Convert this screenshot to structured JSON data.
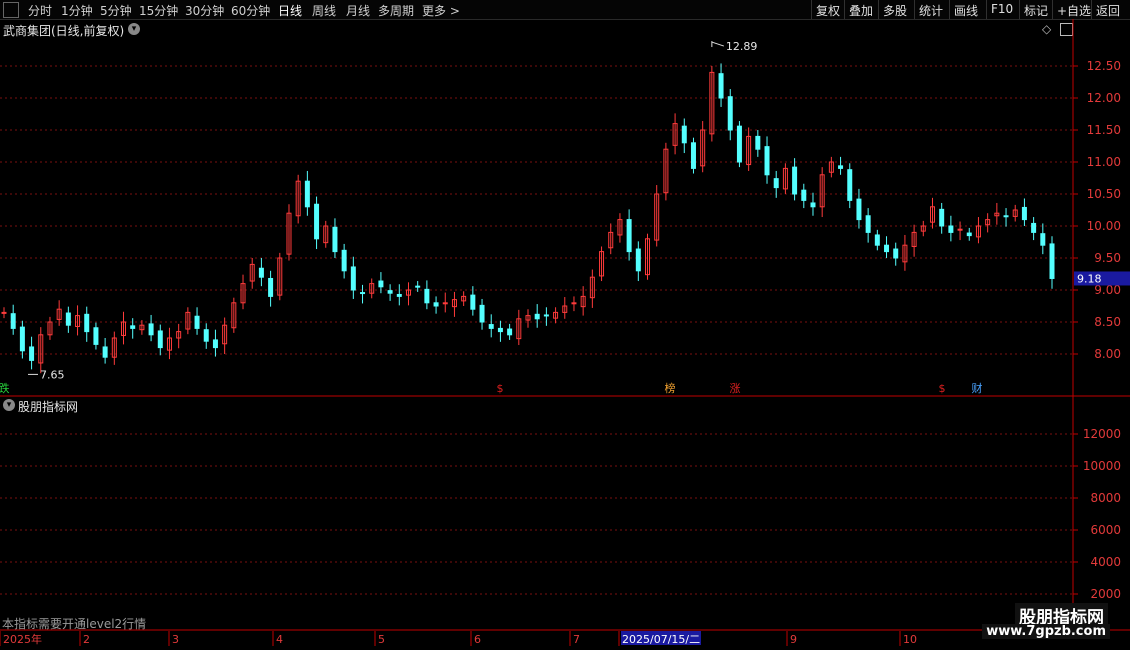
{
  "toolbar": {
    "left_items": [
      "分时",
      "1分钟",
      "5分钟",
      "15分钟",
      "30分钟",
      "60分钟",
      "日线",
      "周线",
      "月线",
      "多周期",
      "更多 >"
    ],
    "active_item": "日线",
    "right_items": [
      "复权",
      "叠加",
      "多股",
      "统计",
      "画线",
      "F10",
      "标记",
      "+自选",
      "返回"
    ]
  },
  "main_panel": {
    "title": "武商集团(日线,前复权)",
    "high_label": "12.89",
    "low_label": "7.65",
    "current_price": "9.18",
    "price_ticks": [
      "12.50",
      "12.00",
      "11.50",
      "11.00",
      "10.50",
      "10.00",
      "9.50",
      "9.00",
      "8.50",
      "8.00"
    ],
    "event_markers": [
      {
        "text": "跌",
        "color": "#27d13c"
      },
      {
        "text": "$",
        "color": "#e02020"
      },
      {
        "text": "榜",
        "color": "#f0a030"
      },
      {
        "text": "涨",
        "color": "#e02020"
      },
      {
        "text": "$",
        "color": "#e02020"
      },
      {
        "text": "财",
        "color": "#4aa3ff"
      }
    ]
  },
  "indicator_panel": {
    "title": "股朋指标网",
    "ticks": [
      "12000",
      "10000",
      "8000",
      "6000",
      "4000",
      "2000"
    ],
    "notice": "本指标需要开通level2行情"
  },
  "time_axis": {
    "labels": [
      "2025年",
      "2",
      "3",
      "4",
      "5",
      "6",
      "7",
      "2025/07/15/二",
      "9",
      "10"
    ],
    "highlight": "2025/07/15/二"
  },
  "watermark": {
    "title": "股朋指标网",
    "url": "www.7gpzb.com"
  },
  "colors": {
    "up": "#ff3b3b",
    "down": "#54ffff",
    "axis": "#c00000",
    "grid": "#7a1010",
    "price_box": "#1a1aa0"
  },
  "chart_data": {
    "type": "candlestick",
    "ylim": [
      7.5,
      13.0
    ],
    "highest": 12.89,
    "lowest": 7.65,
    "last": 9.18,
    "close_path": [
      8.65,
      8.4,
      8.05,
      7.9,
      8.3,
      8.5,
      8.7,
      8.45,
      8.6,
      8.35,
      8.15,
      7.95,
      8.25,
      8.5,
      8.4,
      8.45,
      8.3,
      8.1,
      8.25,
      8.35,
      8.65,
      8.4,
      8.2,
      8.1,
      8.45,
      8.8,
      9.1,
      9.4,
      9.2,
      8.9,
      9.5,
      10.2,
      10.7,
      10.3,
      9.8,
      10.0,
      9.6,
      9.3,
      9.0,
      8.95,
      9.1,
      9.05,
      8.95,
      8.9,
      9.0,
      9.05,
      8.8,
      8.75,
      8.8,
      8.85,
      8.9,
      8.7,
      8.5,
      8.4,
      8.35,
      8.3,
      8.55,
      8.6,
      8.55,
      8.6,
      8.65,
      8.75,
      8.8,
      8.9,
      9.2,
      9.6,
      9.9,
      10.1,
      9.6,
      9.3,
      9.8,
      10.5,
      11.2,
      11.6,
      11.3,
      10.9,
      11.5,
      12.4,
      12.0,
      11.5,
      11.0,
      11.4,
      11.2,
      10.8,
      10.6,
      10.9,
      10.5,
      10.4,
      10.3,
      10.8,
      11.0,
      10.9,
      10.4,
      10.1,
      9.9,
      9.7,
      9.6,
      9.5,
      9.7,
      9.9,
      10.0,
      10.3,
      10.0,
      9.9,
      9.95,
      9.85,
      10.0,
      10.1,
      10.2,
      10.15,
      10.25,
      10.1,
      9.9,
      9.7,
      9.18
    ]
  }
}
